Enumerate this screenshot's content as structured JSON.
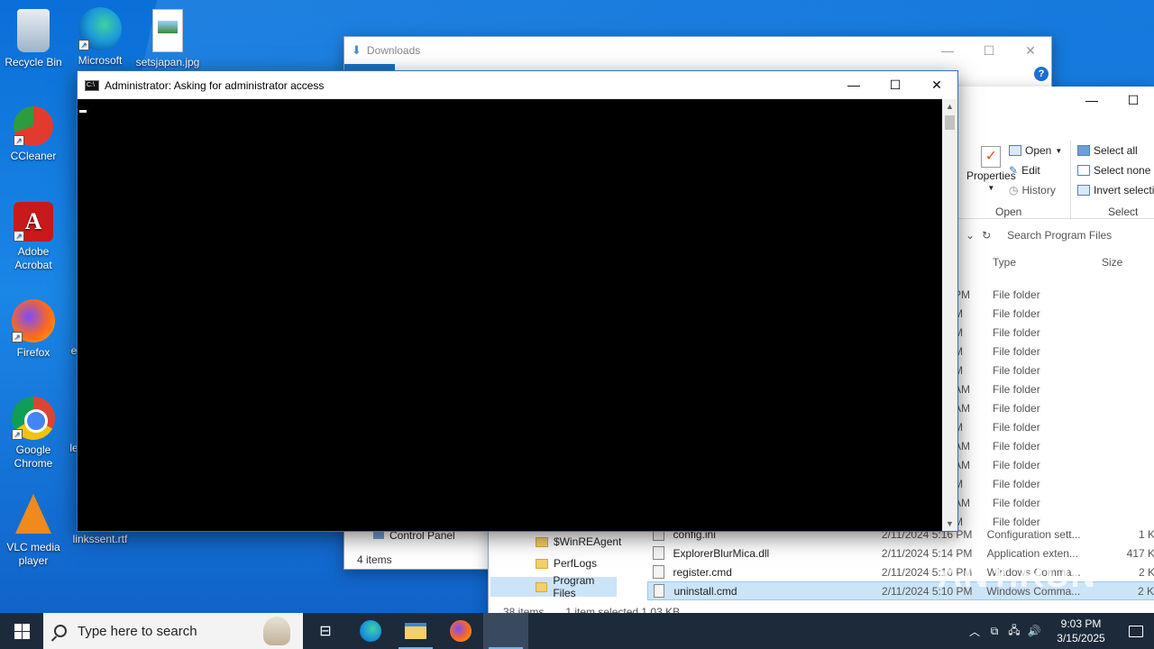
{
  "desktop": {
    "icons": [
      {
        "label": "Recycle Bin",
        "icon": "recycle-bin-icon"
      },
      {
        "label": "Microsoft Edge",
        "icon": "edge-icon"
      },
      {
        "label": "setsjapan.jpg",
        "icon": "image-file-icon"
      },
      {
        "label": "CCleaner",
        "icon": "ccleaner-icon"
      },
      {
        "label": "Adobe Acrobat",
        "icon": "acrobat-icon"
      },
      {
        "label": "Firefox",
        "icon": "firefox-icon"
      },
      {
        "label": "Google Chrome",
        "icon": "chrome-icon"
      },
      {
        "label": "VLC media player",
        "icon": "vlc-icon"
      },
      {
        "label": "linkssent.rtf",
        "icon": "rtf-file-icon"
      }
    ],
    "partial_labels": [
      "e",
      "le"
    ]
  },
  "downloads_window": {
    "title": "Downloads",
    "nav_item": "Control Panel",
    "status": "4 items"
  },
  "explorer": {
    "ribbon": {
      "properties": "Properties",
      "open": "Open",
      "edit": "Edit",
      "history": "History",
      "select_all": "Select all",
      "select_none": "Select none",
      "invert_selection": "Invert selection",
      "group_open": "Open",
      "group_select": "Select"
    },
    "search_placeholder": "Search Program Files",
    "columns": {
      "type": "Type",
      "size": "Size"
    },
    "folder_rows": [
      {
        "time": "PM",
        "type": "File folder"
      },
      {
        "time": "M",
        "type": "File folder"
      },
      {
        "time": "M",
        "type": "File folder"
      },
      {
        "time": "M",
        "type": "File folder"
      },
      {
        "time": "M",
        "type": "File folder"
      },
      {
        "time": "AM",
        "type": "File folder"
      },
      {
        "time": "AM",
        "type": "File folder"
      },
      {
        "time": "M",
        "type": "File folder"
      },
      {
        "time": "AM",
        "type": "File folder"
      },
      {
        "time": "AM",
        "type": "File folder"
      },
      {
        "time": "M",
        "type": "File folder"
      },
      {
        "time": "AM",
        "type": "File folder"
      },
      {
        "time": "M",
        "type": "File folder"
      }
    ],
    "nav": [
      {
        "label": "$WinREAgent"
      },
      {
        "label": "PerfLogs"
      },
      {
        "label": "Program Files"
      }
    ],
    "files": [
      {
        "name": "config.ini",
        "date": "2/11/2024 5:16 PM",
        "type": "Configuration sett...",
        "size": "1 K"
      },
      {
        "name": "ExplorerBlurMica.dll",
        "date": "2/11/2024 5:14 PM",
        "type": "Application exten...",
        "size": "417 K"
      },
      {
        "name": "register.cmd",
        "date": "2/11/2024 5:10 PM",
        "type": "Windows Comma...",
        "size": "2 K"
      },
      {
        "name": "uninstall.cmd",
        "date": "2/11/2024 5:10 PM",
        "type": "Windows Comma...",
        "size": "2 K"
      }
    ],
    "status_items": "38 items",
    "status_selected": "1 item selected  1.03 KB"
  },
  "cmd_window": {
    "title": "Administrator:  Asking for administrator access"
  },
  "watermark": "ANY.RUN",
  "taskbar": {
    "search_placeholder": "Type here to search",
    "time": "9:03 PM",
    "date": "3/15/2025"
  }
}
